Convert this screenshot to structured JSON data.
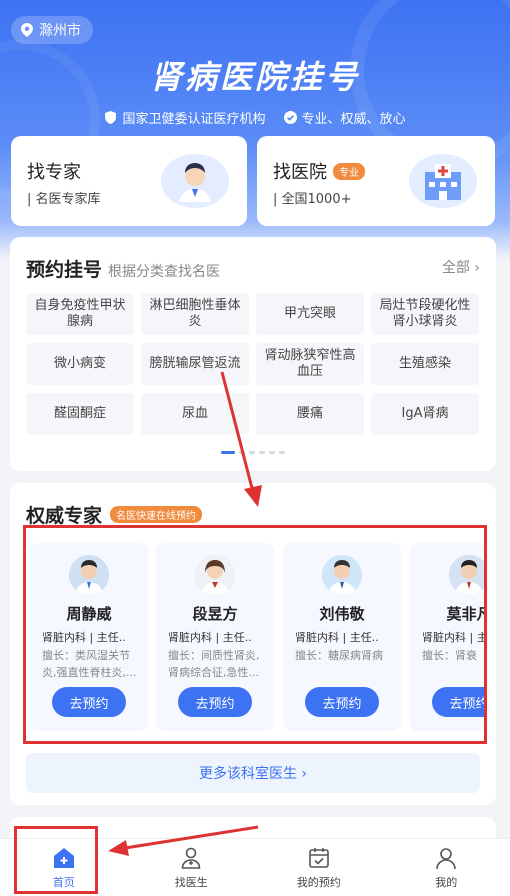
{
  "location": {
    "city": "滁州市"
  },
  "hero": {
    "title": "肾病医院挂号",
    "cert_1": "国家卫健委认证医疗机构",
    "cert_2": "专业、权威、放心"
  },
  "find_expert": {
    "title": "找专家",
    "subtitle": "| 名医专家库"
  },
  "find_hospital": {
    "title": "找医院",
    "tag": "专业",
    "subtitle": "| 全国1000+"
  },
  "registration": {
    "title": "预约挂号",
    "subtitle": "根据分类查找名医",
    "all_label": "全部",
    "categories": [
      "自身免疫性甲状腺病",
      "淋巴细胞性垂体炎",
      "甲亢突眼",
      "局灶节段硬化性肾小球肾炎",
      "微小病变",
      "膀胱输尿管返流",
      "肾动脉狭窄性高血压",
      "生殖感染",
      "醛固酮症",
      "尿血",
      "腰痛",
      "IgA肾病"
    ]
  },
  "experts": {
    "title": "权威专家",
    "tag": "名医快速在线预约",
    "book_label": "去预约",
    "more_label": "更多该科室医生 ›",
    "doctors": [
      {
        "name": "周静威",
        "dept": "肾脏内科 | 主任..",
        "skill": "擅长：类风湿关节炎,强直性脊柱炎,..."
      },
      {
        "name": "段昱方",
        "dept": "肾脏内科 | 主任..",
        "skill": "擅长：间质性肾炎,肾病综合征,急性..."
      },
      {
        "name": "刘伟敬",
        "dept": "肾脏内科 | 主任..",
        "skill": "擅长：糖尿病肾病"
      },
      {
        "name": "莫非凡",
        "dept": "肾脏内科 | 主",
        "skill": "擅长：肾衰"
      }
    ]
  },
  "tabbar": {
    "home": "首页",
    "find_doctor": "找医生",
    "my_appointments": "我的预约",
    "mine": "我的"
  },
  "colors": {
    "primary": "#3d72f2",
    "accent_orange": "#f08a3c",
    "annotation_red": "#d33333"
  }
}
